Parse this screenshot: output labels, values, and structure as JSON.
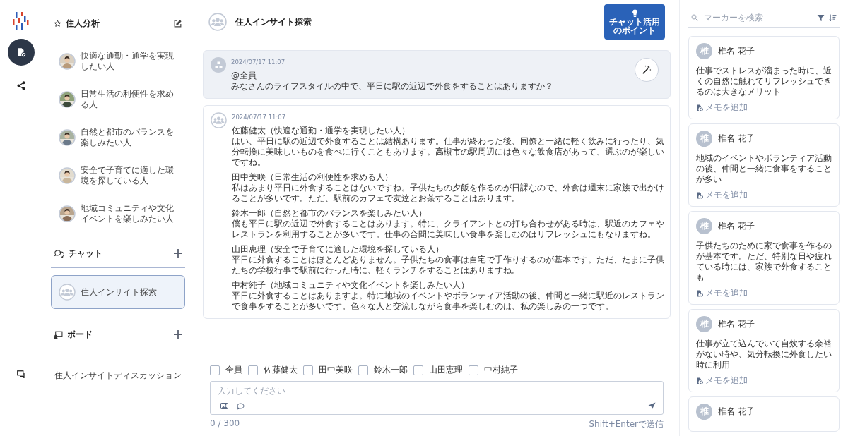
{
  "sidebar": {
    "persona_section": {
      "title": "住人分析"
    },
    "personas": [
      {
        "label": "快適な通勤・通学を実現したい人",
        "selected": false
      },
      {
        "label": "日常生活の利便性を求める人",
        "selected": false
      },
      {
        "label": "自然と都市のバランスを楽しみたい人",
        "selected": false
      },
      {
        "label": "安全で子育てに適した環境を探している人",
        "selected": false
      },
      {
        "label": "地域コミュニティや文化イベントを楽しみたい人",
        "selected": false
      }
    ],
    "chat_section": {
      "title": "チャット"
    },
    "chats": [
      {
        "label": "住人インサイト探索",
        "selected": true
      }
    ],
    "board_section": {
      "title": "ボード"
    },
    "boards": [
      {
        "label": "住人インサイトディスカッション",
        "selected": false
      }
    ]
  },
  "header": {
    "title": "住人インサイト探索",
    "tips_button": "チャット活用のポイント"
  },
  "messages": [
    {
      "kind": "question",
      "time": "2024/07/17 11:07",
      "mention": "@全員",
      "text": "みなさんのライフスタイルの中で、平日に駅の近辺で外食をすることはありますか？"
    },
    {
      "kind": "answer",
      "time": "2024/07/17 11:07",
      "replies": [
        {
          "speaker": "佐藤健太（快適な通勤・通学を実現したい人）",
          "text": "はい、平日に駅の近辺で外食することは結構あります。仕事が終わった後、同僚と一緒に軽く飲みに行ったり、気分転換に美味しいものを食べに行くこともあります。高槻市の駅周辺には色々な飲食店があって、選ぶのが楽しいですね。"
        },
        {
          "speaker": "田中美咲（日常生活の利便性を求める人）",
          "text": "私はあまり平日に外食することはないですね。子供たちの夕飯を作るのが日課なので、外食は週末に家族で出かけることが多いです。ただ、駅前のカフェで友達とお茶することはあります。"
        },
        {
          "speaker": "鈴木一郎（自然と都市のバランスを楽しみたい人）",
          "text": "僕も平日に駅の近辺で外食することはあります。特に、クライアントとの打ち合わせがある時は、駅近のカフェやレストランを利用することが多いです。仕事の合間に美味しい食事を楽しむのはリフレッシュにもなりますね。"
        },
        {
          "speaker": "山田恵理（安全で子育てに適した環境を探している人）",
          "text": "平日に外食することはほとんどありません。子供たちの食事は自宅で手作りするのが基本です。ただ、たまに子供たちの学校行事で駅前に行った時に、軽くランチをすることはありますね。"
        },
        {
          "speaker": "中村純子（地域コミュニティや文化イベントを楽しみたい人）",
          "text": "平日に外食することはありますよ。特に地域のイベントやボランティア活動の後、仲間と一緒に駅近のレストランで食事をすることが多いです。色々な人と交流しながら食事を楽しむのは、私の楽しみの一つです。"
        }
      ]
    }
  ],
  "recipients": [
    {
      "label": "全員",
      "checked": false
    },
    {
      "label": "佐藤健太",
      "checked": false
    },
    {
      "label": "田中美咲",
      "checked": false
    },
    {
      "label": "鈴木一郎",
      "checked": false
    },
    {
      "label": "山田恵理",
      "checked": false
    },
    {
      "label": "中村純子",
      "checked": false
    }
  ],
  "composer": {
    "placeholder": "入力してください",
    "counter": "0 / 300",
    "hint": "Shift+Enterで送信"
  },
  "markers": {
    "search": {
      "placeholder": "マーカーを検索"
    },
    "items": [
      {
        "avatar": "椎",
        "author": "椎名 花子",
        "text": "仕事でストレスが溜まった時に、近くの自然に触れてリフレッシュできるのは大きなメリット",
        "memo": "メモを追加"
      },
      {
        "avatar": "椎",
        "author": "椎名 花子",
        "text": "地域のイベントやボランティア活動の後、仲間と一緒に食事をすることが多い",
        "memo": "メモを追加"
      },
      {
        "avatar": "椎",
        "author": "椎名 花子",
        "text": "子供たちのために家で食事を作るのが基本です。ただ、特別な日や疲れている時には、家族で外食することも",
        "memo": "メモを追加"
      },
      {
        "avatar": "椎",
        "author": "椎名 花子",
        "text": "仕事が立て込んでいて自炊する余裕がない時や、気分転換に外食したい時に利用",
        "memo": "メモを追加"
      },
      {
        "avatar": "椎",
        "author": "椎名 花子"
      }
    ]
  }
}
